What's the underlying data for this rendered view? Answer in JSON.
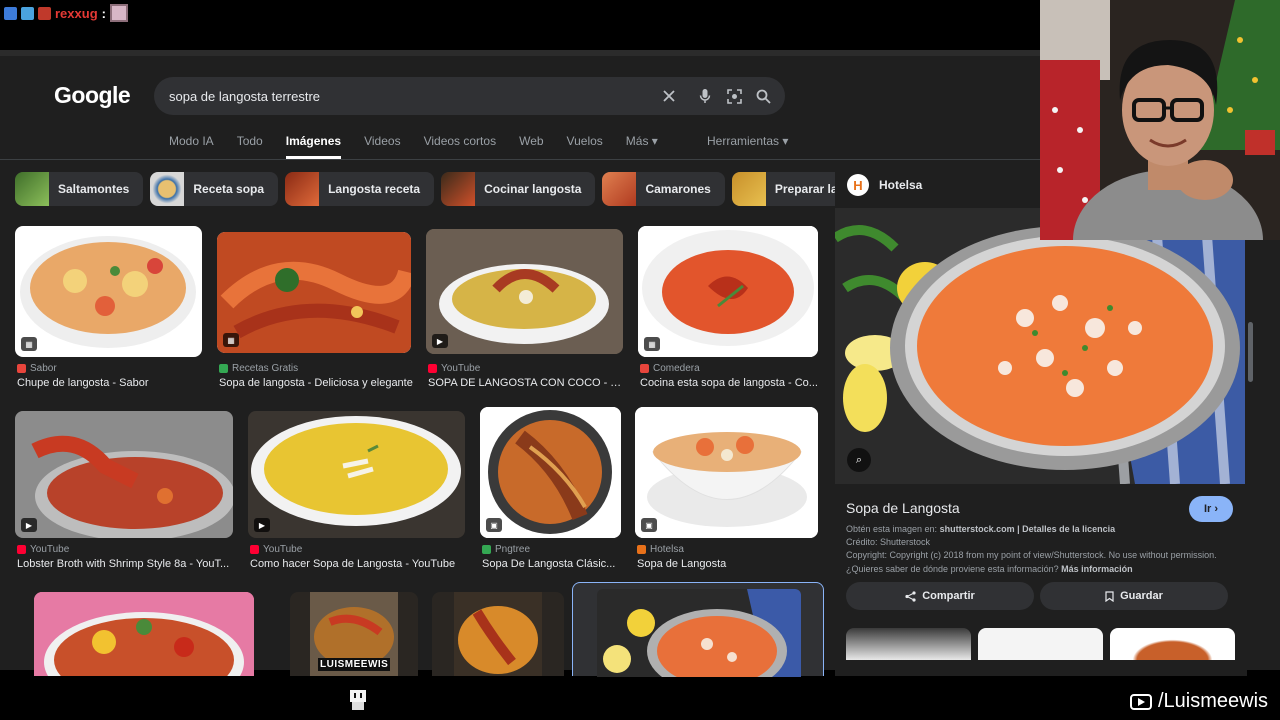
{
  "chat": {
    "username": "rexxug",
    "separator": ":"
  },
  "search": {
    "logo": "Google",
    "query": "sopa de langosta terrestre"
  },
  "tabs": [
    {
      "label": "Modo IA",
      "active": false
    },
    {
      "label": "Todo",
      "active": false
    },
    {
      "label": "Imágenes",
      "active": true
    },
    {
      "label": "Videos",
      "active": false
    },
    {
      "label": "Videos cortos",
      "active": false
    },
    {
      "label": "Web",
      "active": false
    },
    {
      "label": "Vuelos",
      "active": false
    },
    {
      "label": "Más ▾",
      "active": false
    }
  ],
  "tools_label": "Herramientas ▾",
  "chips": [
    {
      "label": "Saltamontes",
      "color": "#5b8a3a"
    },
    {
      "label": "Receta sopa",
      "color": "#c9a15a"
    },
    {
      "label": "Langosta receta",
      "color": "#c0502a"
    },
    {
      "label": "Cocinar langosta",
      "color": "#b84a25"
    },
    {
      "label": "Camarones",
      "color": "#d0603a"
    },
    {
      "label": "Preparar langosta",
      "color": "#c89a3a"
    }
  ],
  "results": [
    {
      "source": "Sabor",
      "title": "Chupe de langosta - Sabor",
      "icon": "#e8453c",
      "badge": "grid"
    },
    {
      "source": "Recetas Gratis",
      "title": "Sopa de langosta - Deliciosa y elegante",
      "icon": "#34a853",
      "badge": "grid"
    },
    {
      "source": "YouTube",
      "title": "SOPA DE LANGOSTA CON COCO - Y...",
      "icon": "#ff0033",
      "badge": "play"
    },
    {
      "source": "Comedera",
      "title": "Cocina esta sopa de langosta - Co...",
      "icon": "#e8453c",
      "badge": "grid"
    },
    {
      "source": "YouTube",
      "title": "Lobster Broth with Shrimp Style 8a - YouT...",
      "icon": "#ff0033",
      "badge": "play"
    },
    {
      "source": "YouTube",
      "title": "Como hacer Sopa de Langosta - YouTube",
      "icon": "#ff0033",
      "badge": "play"
    },
    {
      "source": "Pngtree",
      "title": "Sopa De Langosta Clásic...",
      "icon": "#34a853",
      "badge": "img"
    },
    {
      "source": "Hotelsa",
      "title": "Sopa de Langosta",
      "icon": "#e8711a",
      "badge": "img"
    }
  ],
  "preview": {
    "site": "Hotelsa",
    "favicon_letter": "H",
    "title": "Sopa de Langosta",
    "go_label": "Ir ›",
    "line1_prefix": "Obtén esta imagen en:",
    "line1_source": "shutterstock.com | Detalles de la licencia",
    "line2": "Crédito: Shutterstock",
    "line3": "Copyright: Copyright (c) 2018 from my point of view/Shutterstock. No use without permission.",
    "line4_prefix": "¿Quieres saber de dónde proviene esta información?",
    "line4_link": "Más información",
    "share_label": "Compartir",
    "save_label": "Guardar"
  },
  "overlay": {
    "channel": "/Luismeewis",
    "watermark": "LUISMEEWIS"
  }
}
